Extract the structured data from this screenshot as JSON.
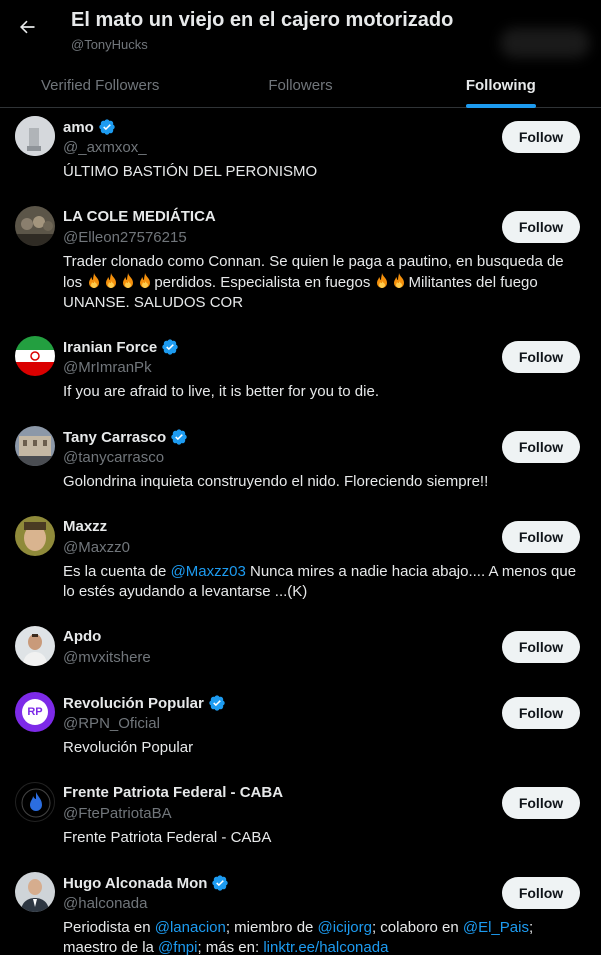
{
  "header": {
    "title": "El mato un viejo en el cajero motorizado",
    "handle": "@TonyHucks",
    "back_icon": "arrow-left-icon"
  },
  "tabs": [
    {
      "label": "Verified Followers",
      "active": false
    },
    {
      "label": "Followers",
      "active": false
    },
    {
      "label": "Following",
      "active": true
    }
  ],
  "colors": {
    "accent": "#1d9bf0",
    "background": "#000000",
    "text_primary": "#e7e9ea",
    "text_secondary": "#71767b",
    "follow_button_bg": "#eff3f4"
  },
  "follow_label": "Follow",
  "users": [
    {
      "name": "amo",
      "handle": "@_axmxox_",
      "verified": true,
      "bio": "ÚLTIMO BASTIÓN DEL PERONISMO"
    },
    {
      "name": "LA COLE MEDIÁTICA",
      "handle": "@Elleon27576215",
      "verified": false,
      "bio_l1": "Trader clonado como Connan. Se quien le paga a pautino, en busqueda de",
      "bio_l2a": "los ",
      "bio_l2b": "perdidos. Especialista en fuegos ",
      "bio_l2c": "Militantes del fuego",
      "bio_l3": "UNANSE. SALUDOS COR"
    },
    {
      "name": "Iranian Force",
      "handle": "@MrImranPk",
      "verified": true,
      "bio": "If you are afraid to live, it is better for you to die."
    },
    {
      "name": "Tany Carrasco",
      "handle": "@tanycarrasco",
      "verified": true,
      "bio": "Golondrina inquieta construyendo el nido. Floreciendo siempre!!"
    },
    {
      "name": "Maxzz",
      "handle": "@Maxzz0",
      "verified": false,
      "bio_a": "Es la cuenta de ",
      "bio_mention": "@Maxzz03",
      "bio_b": " Nunca mires a nadie hacia abajo.... A menos que",
      "bio_l2": "lo estés ayudando a levantarse ...(K)"
    },
    {
      "name": "Apdo",
      "handle": "@mvxitshere",
      "verified": false,
      "bio": ""
    },
    {
      "name": "Revolución Popular",
      "handle": "@RPN_Oficial",
      "verified": true,
      "bio": "Revolución Popular",
      "avatar_text": "RP"
    },
    {
      "name": "Frente Patriota Federal - CABA",
      "handle": "@FtePatriotaBA",
      "verified": false,
      "bio": "Frente Patriota Federal - CABA"
    },
    {
      "name": "Hugo Alconada Mon",
      "handle": "@halconada",
      "verified": true,
      "bio_a": "Periodista en ",
      "m1": "@lanacion",
      "bio_b": "; miembro de ",
      "m2": "@icijorg",
      "bio_c": "; colaboro en ",
      "m3": "@El_Pais",
      "bio_d": ";",
      "bio_e": "maestro de la ",
      "m4": "@fnpi",
      "bio_f": "; más en: ",
      "m5": "linktr.ee/halconada"
    }
  ]
}
